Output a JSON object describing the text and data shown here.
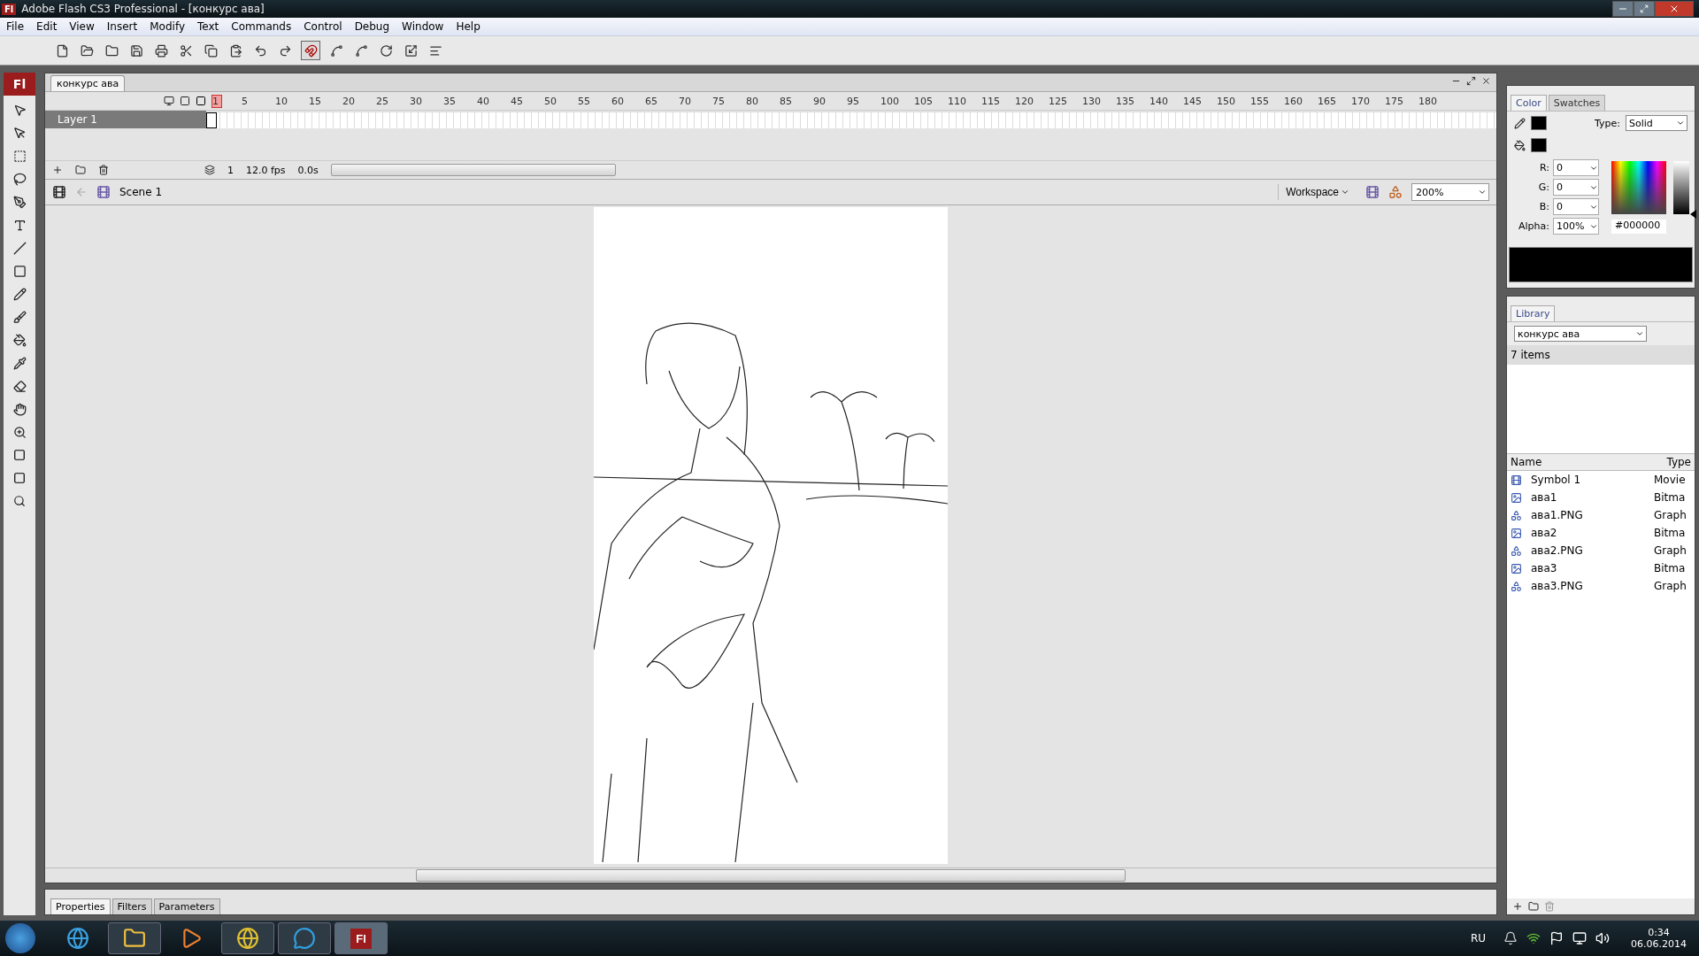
{
  "window": {
    "app_icon": "Fl",
    "title": "Adobe Flash CS3 Professional - [конкурс ава]"
  },
  "menu": [
    "File",
    "Edit",
    "View",
    "Insert",
    "Modify",
    "Text",
    "Commands",
    "Control",
    "Debug",
    "Window",
    "Help"
  ],
  "tools_logo": "Fl",
  "document_tabs": [
    {
      "label": "конкурс ава",
      "selected": true
    }
  ],
  "timeline": {
    "frame_ticks": [
      "1",
      "5",
      "10",
      "15",
      "20",
      "25",
      "30",
      "35",
      "40",
      "45",
      "50",
      "55",
      "60",
      "65",
      "70",
      "75",
      "80",
      "85",
      "90",
      "95",
      "100",
      "105",
      "110",
      "115",
      "120",
      "125",
      "130",
      "135",
      "140",
      "145",
      "150",
      "155",
      "160",
      "165",
      "170",
      "175",
      "180"
    ],
    "layers": [
      {
        "name": "Layer 1",
        "selected": true
      }
    ],
    "current_frame": "1",
    "fps": "12.0 fps",
    "elapsed": "0.0s"
  },
  "edit_bar": {
    "scene": "Scene 1",
    "workspace": "Workspace",
    "zoom": "200%"
  },
  "color_panel": {
    "tabs": [
      {
        "label": "Color",
        "selected": true
      },
      {
        "label": "Swatches",
        "selected": false
      }
    ],
    "type_label": "Type:",
    "type": "Solid",
    "channels": [
      {
        "label": "R:",
        "value": "0"
      },
      {
        "label": "G:",
        "value": "0"
      },
      {
        "label": "B:",
        "value": "0"
      },
      {
        "label": "Alpha:",
        "value": "100%"
      }
    ],
    "hex": "#000000",
    "brightness": {
      "level": 0
    }
  },
  "library": {
    "tabs": [
      {
        "label": "Library",
        "selected": true
      }
    ],
    "document": "конкурс ава",
    "count": "7 items",
    "columns": [
      "Name",
      "Type"
    ],
    "items": [
      {
        "kind": "movie",
        "name": "Symbol 1",
        "type": "Movie"
      },
      {
        "kind": "bitmap",
        "name": "ава1",
        "type": "Bitma"
      },
      {
        "kind": "graphic",
        "name": "ава1.PNG",
        "type": "Graph"
      },
      {
        "kind": "bitmap",
        "name": "ава2",
        "type": "Bitma"
      },
      {
        "kind": "graphic",
        "name": "ава2.PNG",
        "type": "Graph"
      },
      {
        "kind": "bitmap",
        "name": "ава3",
        "type": "Bitma"
      },
      {
        "kind": "graphic",
        "name": "ава3.PNG",
        "type": "Graph"
      }
    ]
  },
  "properties_tabs": [
    {
      "label": "Properties",
      "selected": true
    },
    {
      "label": "Filters",
      "selected": false
    },
    {
      "label": "Parameters",
      "selected": false
    }
  ],
  "taskbar": {
    "apps": [
      {
        "kind": "browser",
        "running": false,
        "selected": false
      },
      {
        "kind": "folder",
        "running": true,
        "selected": false
      },
      {
        "kind": "media",
        "running": false,
        "selected": false
      },
      {
        "kind": "chrome",
        "running": true,
        "selected": false
      },
      {
        "kind": "skype",
        "running": true,
        "selected": false
      },
      {
        "kind": "flash",
        "label": "Fl",
        "running": true,
        "selected": true
      }
    ],
    "language": "RU",
    "time": "0:34",
    "date": "06.06.2014"
  }
}
